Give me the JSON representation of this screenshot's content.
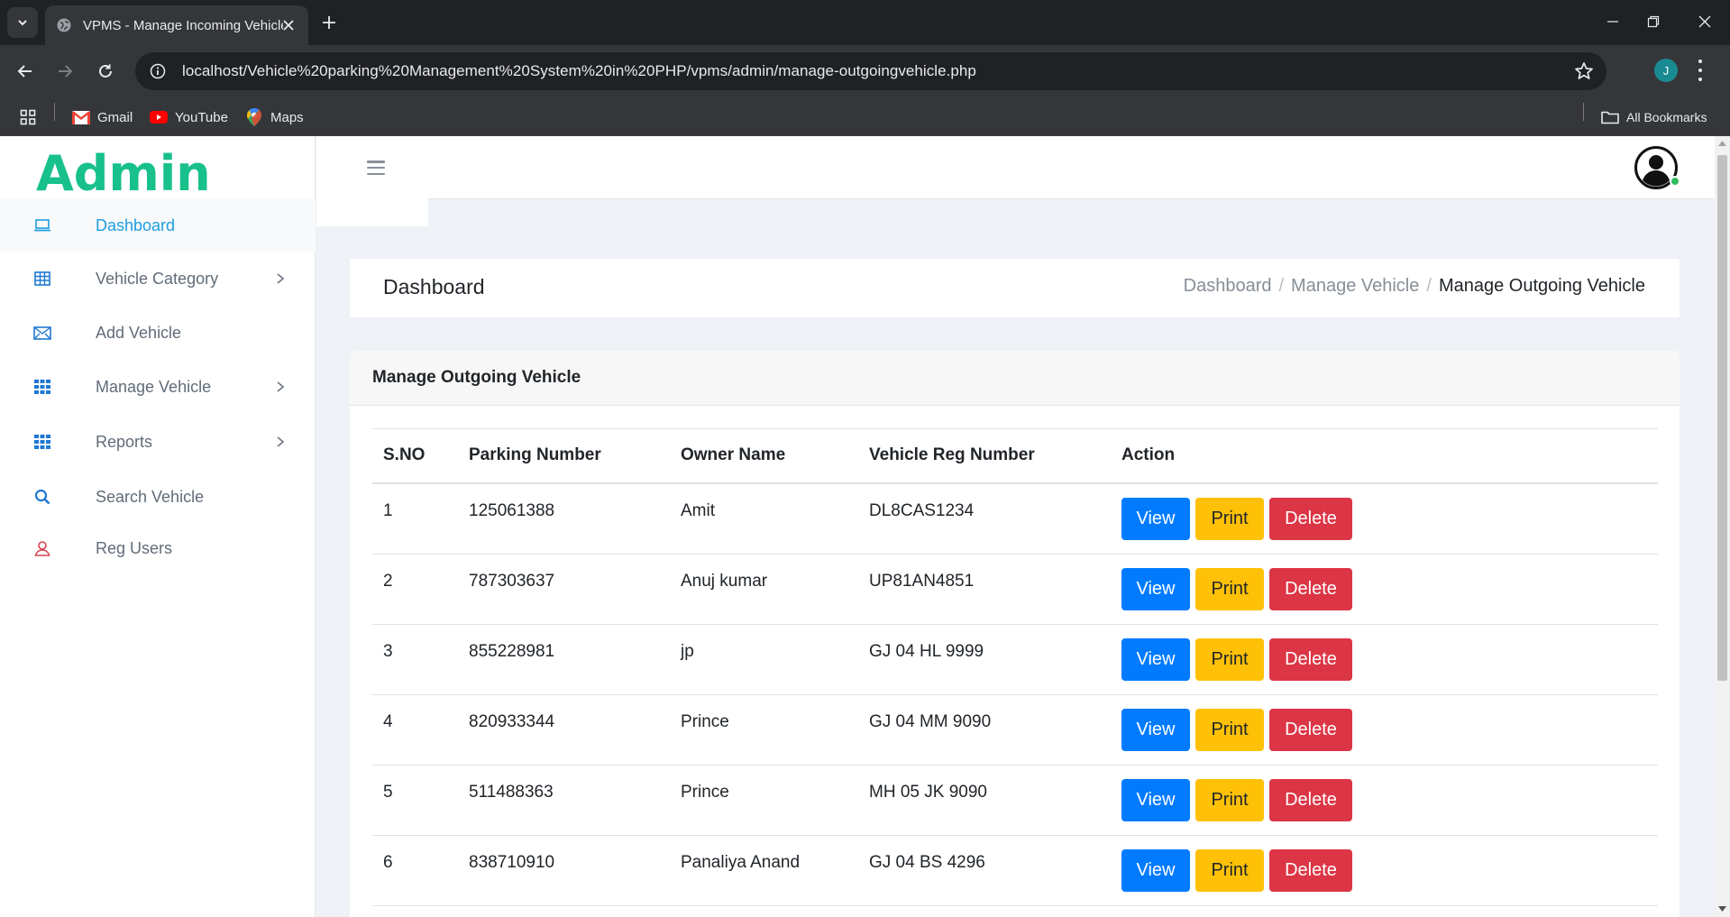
{
  "browser": {
    "tab_title": "VPMS - Manage Incoming Vehicle",
    "url": "localhost/Vehicle%20parking%20Management%20System%20in%20PHP/vpms/admin/manage-outgoingvehicle.php",
    "profile_initial": "J",
    "bookmarks": [
      {
        "label": "Gmail",
        "icon": "gmail-icon"
      },
      {
        "label": "YouTube",
        "icon": "youtube-icon"
      },
      {
        "label": "Maps",
        "icon": "maps-icon"
      }
    ],
    "all_bookmarks": "All Bookmarks"
  },
  "sidebar": {
    "logo": "Admin",
    "items": [
      {
        "label": "Dashboard",
        "icon": "laptop-icon",
        "active": true
      },
      {
        "label": "Vehicle Category",
        "icon": "table-icon",
        "submenu": true
      },
      {
        "label": "Add Vehicle",
        "icon": "envelope-icon"
      },
      {
        "label": "Manage Vehicle",
        "icon": "grid-icon",
        "submenu": true
      },
      {
        "label": "Reports",
        "icon": "grid-icon",
        "submenu": true
      },
      {
        "label": "Search Vehicle",
        "icon": "search-icon"
      },
      {
        "label": "Reg Users",
        "icon": "user-icon"
      }
    ]
  },
  "header": {
    "title": "Dashboard",
    "breadcrumb": [
      "Dashboard",
      "Manage Vehicle",
      "Manage Outgoing Vehicle"
    ]
  },
  "card": {
    "title": "Manage Outgoing Vehicle",
    "columns": [
      "S.NO",
      "Parking Number",
      "Owner Name",
      "Vehicle Reg Number",
      "Action"
    ],
    "rows": [
      {
        "sno": "1",
        "parking": "125061388",
        "owner": "Amit",
        "reg": "DL8CAS1234"
      },
      {
        "sno": "2",
        "parking": "787303637",
        "owner": "Anuj kumar",
        "reg": "UP81AN4851"
      },
      {
        "sno": "3",
        "parking": "855228981",
        "owner": "jp",
        "reg": "GJ 04 HL 9999"
      },
      {
        "sno": "4",
        "parking": "820933344",
        "owner": "Prince",
        "reg": "GJ 04 MM 9090"
      },
      {
        "sno": "5",
        "parking": "511488363",
        "owner": "Prince",
        "reg": "MH 05 JK 9090"
      },
      {
        "sno": "6",
        "parking": "838710910",
        "owner": "Panaliya Anand",
        "reg": "GJ 04 BS 4296"
      }
    ],
    "actions": {
      "view": "View",
      "print": "Print",
      "delete": "Delete"
    }
  },
  "colors": {
    "logo": "#18c08c",
    "active_nav": "#1e9ee0",
    "view": "#007bff",
    "print": "#ffc107",
    "delete": "#dc3545"
  }
}
